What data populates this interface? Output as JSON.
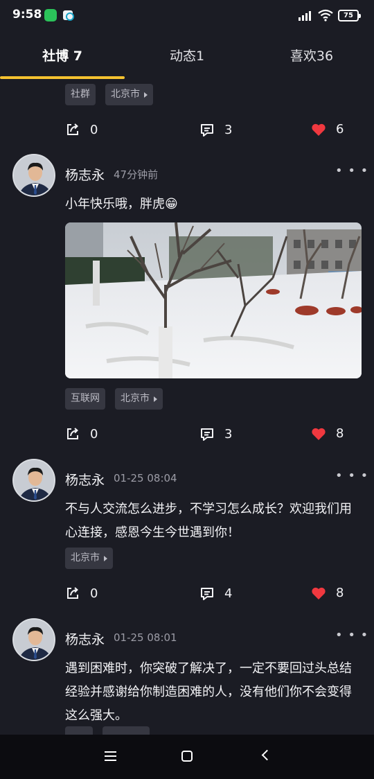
{
  "status_bar": {
    "time": "9:58",
    "battery": "75"
  },
  "tabs": [
    {
      "label": "社博 7",
      "active": true
    },
    {
      "label": "动态1",
      "active": false
    },
    {
      "label": "喜欢36",
      "active": false
    }
  ],
  "posts": [
    {
      "tags": [
        "社群",
        "北京市"
      ],
      "shares": "0",
      "comments": "3",
      "likes": "6"
    },
    {
      "author": "杨志永",
      "time": "47分钟前",
      "text": "小年快乐哦，胖虎😁",
      "tags": [
        "互联网",
        "北京市"
      ],
      "shares": "0",
      "comments": "3",
      "likes": "8"
    },
    {
      "author": "杨志永",
      "time": "01-25 08:04",
      "text": "不与人交流怎么进步，不学习怎么成长？欢迎我们用心连接，感恩今生今世遇到你！",
      "tags": [
        "北京市"
      ],
      "shares": "0",
      "comments": "4",
      "likes": "8"
    },
    {
      "author": "杨志永",
      "time": "01-25 08:01",
      "text": "遇到困难时，你突破了解决了，一定不要回过头总结经验并感谢给你制造困难的人，没有他们你不会变得这么强大。"
    }
  ],
  "colors": {
    "accent": "#f5c230",
    "like": "#f0383f",
    "background": "#1b1c24"
  }
}
